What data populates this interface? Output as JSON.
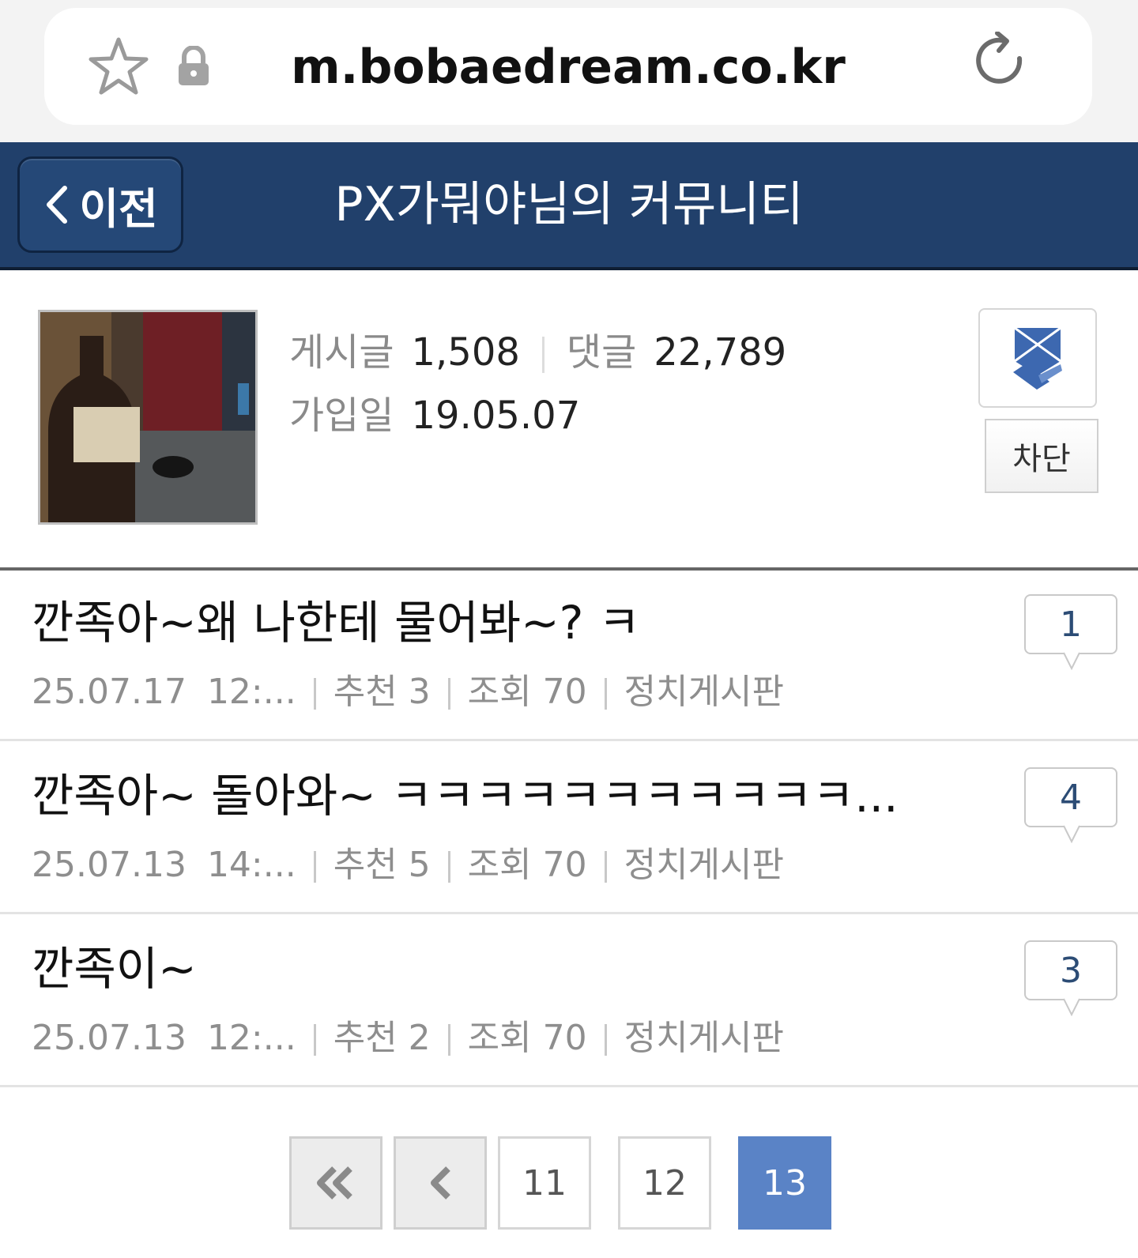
{
  "browser": {
    "url": "m.bobaedream.co.kr"
  },
  "header": {
    "back_label": "이전",
    "title": "PX가뭐야님의 커뮤니티"
  },
  "profile": {
    "posts_label": "게시글",
    "posts_count": "1,508",
    "comments_label": "댓글",
    "comments_count": "22,789",
    "joined_label": "가입일",
    "joined_date": "19.05.07",
    "block_label": "차단"
  },
  "posts": [
    {
      "title": "깐족아~왜 나한테 물어봐~? ㅋ",
      "date": "25.07.17",
      "time": "12:...",
      "recommend_label": "추천 3",
      "views_label": "조회 70",
      "board": "정치게시판",
      "comments": "1"
    },
    {
      "title": "깐족아~ 돌아와~ ㅋㅋㅋㅋㅋㅋㅋㅋㅋㅋㅋ...",
      "date": "25.07.13",
      "time": "14:...",
      "recommend_label": "추천 5",
      "views_label": "조회 70",
      "board": "정치게시판",
      "comments": "4"
    },
    {
      "title": "깐족이~",
      "date": "25.07.13",
      "time": "12:...",
      "recommend_label": "추천 2",
      "views_label": "조회 70",
      "board": "정치게시판",
      "comments": "3"
    }
  ],
  "pagination": {
    "first_icon": "double-chevron-left-icon",
    "prev_icon": "chevron-left-icon",
    "pages": [
      "11",
      "12",
      "13"
    ],
    "current": "13"
  },
  "colors": {
    "header_bg": "#21406b",
    "active_page": "#5a83c6",
    "comment_count": "#2c4c75"
  }
}
